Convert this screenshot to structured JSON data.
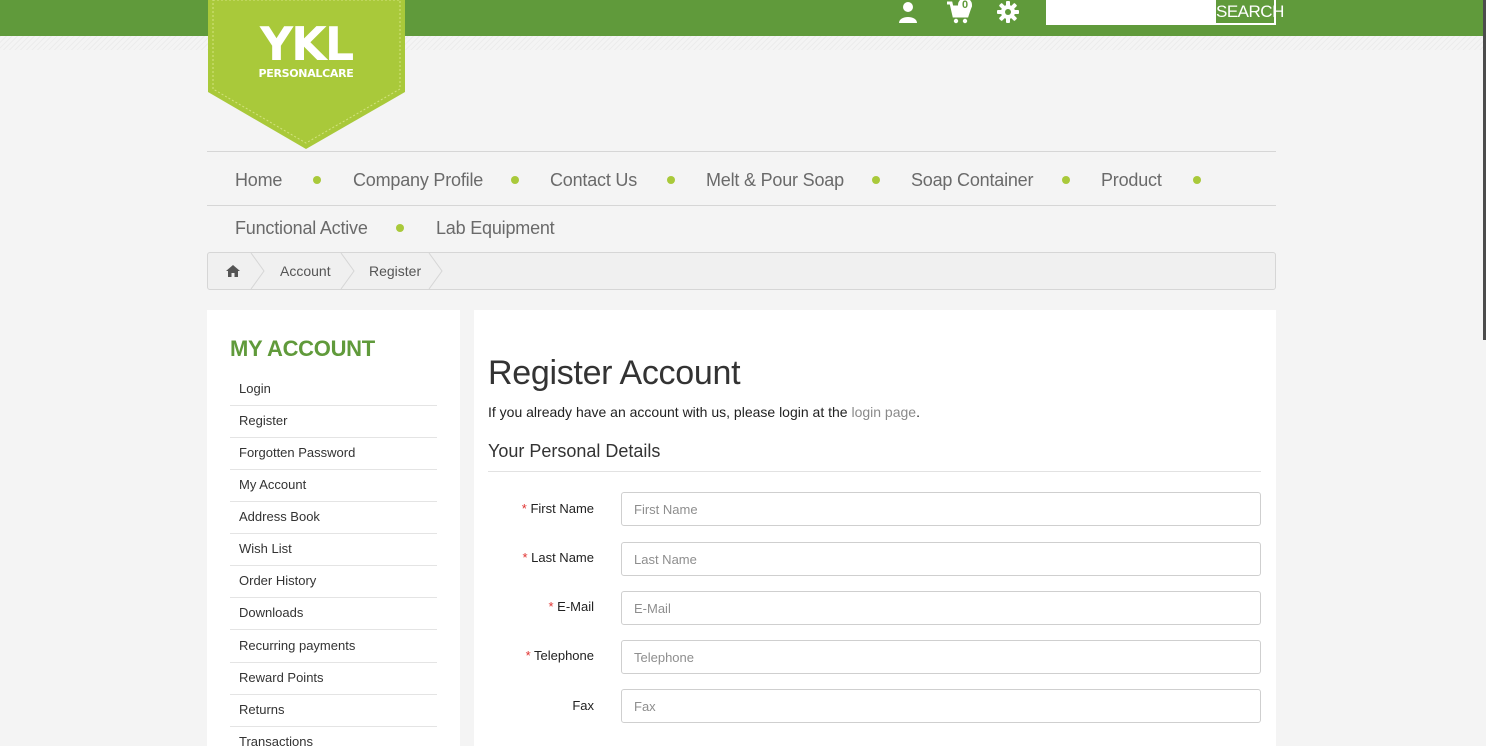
{
  "header": {
    "logo_main": "YKL",
    "logo_sub": "PERSONALCARE",
    "cart_count": "0",
    "search_placeholder": "",
    "search_button": "SEARCH"
  },
  "nav": {
    "row1": [
      "Home",
      "Company Profile",
      "Contact Us",
      "Melt & Pour Soap",
      "Soap Container",
      "Product"
    ],
    "row2": [
      "Functional Active",
      "Lab Equipment"
    ]
  },
  "breadcrumb": [
    "Account",
    "Register"
  ],
  "sidebar": {
    "title": "MY ACCOUNT",
    "links": [
      "Login",
      "Register",
      "Forgotten Password",
      "My Account",
      "Address Book",
      "Wish List",
      "Order History",
      "Downloads",
      "Recurring payments",
      "Reward Points",
      "Returns",
      "Transactions"
    ]
  },
  "main": {
    "title": "Register Account",
    "intro_text": "If you already have an account with us, please login at the ",
    "intro_link": "login page",
    "intro_end": ".",
    "section_title": "Your Personal Details",
    "fields": [
      {
        "label": "First Name",
        "placeholder": "First Name",
        "required": true
      },
      {
        "label": "Last Name",
        "placeholder": "Last Name",
        "required": true
      },
      {
        "label": "E-Mail",
        "placeholder": "E-Mail",
        "required": true
      },
      {
        "label": "Telephone",
        "placeholder": "Telephone",
        "required": true
      },
      {
        "label": "Fax",
        "placeholder": "Fax",
        "required": false
      }
    ]
  },
  "colors": {
    "brand_green": "#609a3b",
    "logo_green": "#a9c93a",
    "required_star": "#e0312f"
  }
}
